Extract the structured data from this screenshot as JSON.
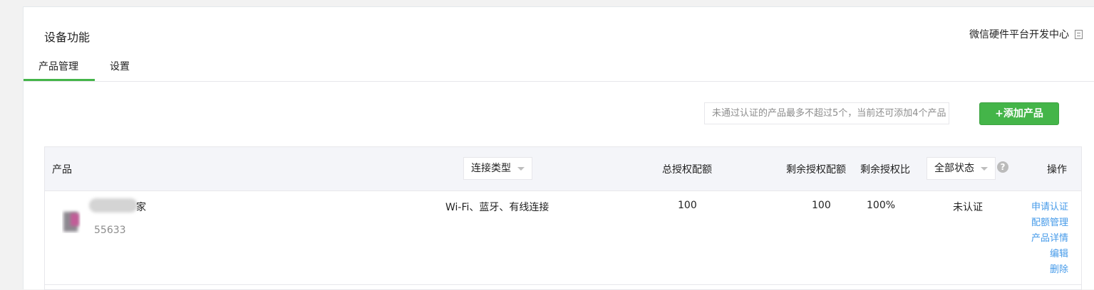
{
  "header": {
    "title": "设备功能",
    "dev_center_link": "微信硬件平台开发中心",
    "dev_center_icon": "document-icon"
  },
  "tabs": [
    {
      "label": "产品管理",
      "active": true
    },
    {
      "label": "设置",
      "active": false
    }
  ],
  "toolbar": {
    "notice": "未通过认证的产品最多不超过5个，当前还可添加4个产品",
    "add_label": "+添加产品"
  },
  "table": {
    "headers": {
      "product": "产品",
      "connection_type": "连接类型",
      "total_quota": "总授权配额",
      "remaining_quota": "剩余授权配额",
      "remaining_ratio": "剩余授权比",
      "status_filter": "全部状态",
      "help": "?",
      "actions": "操作"
    },
    "rows": [
      {
        "name_visible": "家",
        "id": "55633",
        "connection": "Wi-Fi、蓝牙、有线连接",
        "total_quota": "100",
        "remaining_quota": "100",
        "remaining_ratio": "100%",
        "status": "未认证",
        "actions": [
          "申请认证",
          "配额管理",
          "产品详情",
          "编辑",
          "删除"
        ]
      }
    ]
  },
  "colors": {
    "accent_green": "#44b549",
    "link_blue": "#459ae9",
    "header_bg": "#f4f5f9"
  }
}
